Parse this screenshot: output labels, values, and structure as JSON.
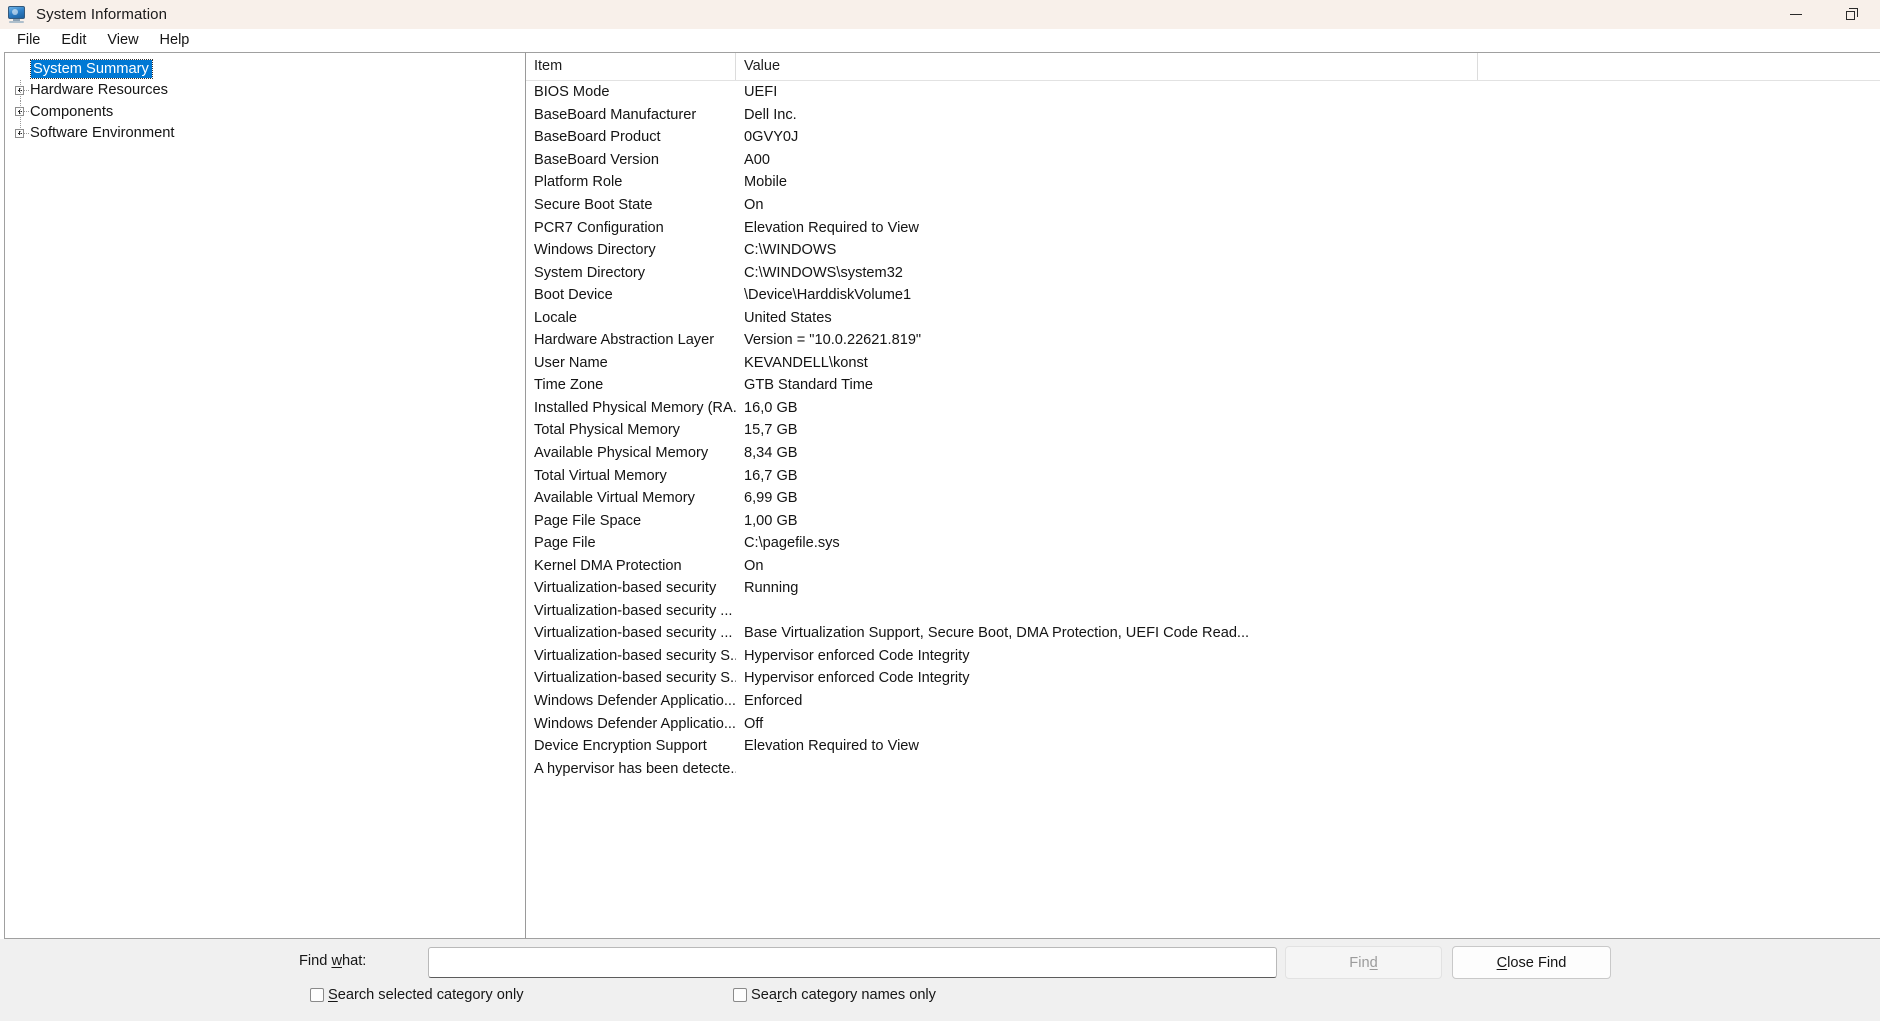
{
  "window": {
    "title": "System Information",
    "app_icon": "monitor-icon",
    "controls": [
      {
        "name": "minimize-button",
        "icon": "minimize-icon"
      },
      {
        "name": "restore-button",
        "icon": "restore-icon"
      }
    ]
  },
  "menubar": {
    "items": [
      {
        "label": "File"
      },
      {
        "label": "Edit"
      },
      {
        "label": "View"
      },
      {
        "label": "Help"
      }
    ]
  },
  "tree": {
    "items": [
      {
        "label": "System Summary",
        "expandable": false,
        "selected": true
      },
      {
        "label": "Hardware Resources",
        "expandable": true,
        "selected": false
      },
      {
        "label": "Components",
        "expandable": true,
        "selected": false
      },
      {
        "label": "Software Environment",
        "expandable": true,
        "selected": false
      }
    ]
  },
  "list": {
    "columns": [
      {
        "label": "Item"
      },
      {
        "label": "Value"
      },
      {
        "label": ""
      }
    ],
    "rows": [
      {
        "item": "BIOS Mode",
        "value": "UEFI"
      },
      {
        "item": "BaseBoard Manufacturer",
        "value": "Dell Inc."
      },
      {
        "item": "BaseBoard Product",
        "value": "0GVY0J"
      },
      {
        "item": "BaseBoard Version",
        "value": "A00"
      },
      {
        "item": "Platform Role",
        "value": "Mobile"
      },
      {
        "item": "Secure Boot State",
        "value": "On"
      },
      {
        "item": "PCR7 Configuration",
        "value": "Elevation Required to View"
      },
      {
        "item": "Windows Directory",
        "value": "C:\\WINDOWS"
      },
      {
        "item": "System Directory",
        "value": "C:\\WINDOWS\\system32"
      },
      {
        "item": "Boot Device",
        "value": "\\Device\\HarddiskVolume1"
      },
      {
        "item": "Locale",
        "value": "United States"
      },
      {
        "item": "Hardware Abstraction Layer",
        "value": "Version = \"10.0.22621.819\""
      },
      {
        "item": "User Name",
        "value": "KEVANDELL\\konst"
      },
      {
        "item": "Time Zone",
        "value": "GTB Standard Time"
      },
      {
        "item": "Installed Physical Memory (RA...",
        "value": "16,0 GB"
      },
      {
        "item": "Total Physical Memory",
        "value": "15,7 GB"
      },
      {
        "item": "Available Physical Memory",
        "value": "8,34 GB"
      },
      {
        "item": "Total Virtual Memory",
        "value": "16,7 GB"
      },
      {
        "item": "Available Virtual Memory",
        "value": "6,99 GB"
      },
      {
        "item": "Page File Space",
        "value": "1,00 GB"
      },
      {
        "item": "Page File",
        "value": "C:\\pagefile.sys"
      },
      {
        "item": "Kernel DMA Protection",
        "value": "On"
      },
      {
        "item": "Virtualization-based security",
        "value": "Running"
      },
      {
        "item": "Virtualization-based security ...",
        "value": ""
      },
      {
        "item": "Virtualization-based security ...",
        "value": "Base Virtualization Support, Secure Boot, DMA Protection, UEFI Code Read..."
      },
      {
        "item": "Virtualization-based security S...",
        "value": "Hypervisor enforced Code Integrity"
      },
      {
        "item": "Virtualization-based security S...",
        "value": "Hypervisor enforced Code Integrity"
      },
      {
        "item": "Windows Defender Applicatio...",
        "value": "Enforced"
      },
      {
        "item": "Windows Defender Applicatio...",
        "value": "Off"
      },
      {
        "item": "Device Encryption Support",
        "value": "Elevation Required to View"
      },
      {
        "item": "A hypervisor has been detecte...",
        "value": ""
      }
    ]
  },
  "findbar": {
    "label_prefix": "Find ",
    "label_accel": "w",
    "label_suffix": "hat:",
    "input_value": "",
    "input_placeholder": "",
    "find_button": {
      "prefix": "Fin",
      "accel": "d",
      "suffix": "",
      "enabled": false
    },
    "close_find_button": {
      "prefix": "",
      "accel": "C",
      "suffix": "lose Find",
      "enabled": true
    },
    "checkboxes": [
      {
        "prefix": "",
        "accel": "S",
        "suffix": "earch selected category only",
        "checked": false
      },
      {
        "prefix": "Sea",
        "accel": "r",
        "suffix": "ch category names only",
        "checked": false
      }
    ]
  },
  "colors": {
    "titlebar_bg": "#f8f0ea",
    "selection": "#0078d4",
    "findbar_bg": "#f0f0f0",
    "border": "#a0a0a0"
  }
}
